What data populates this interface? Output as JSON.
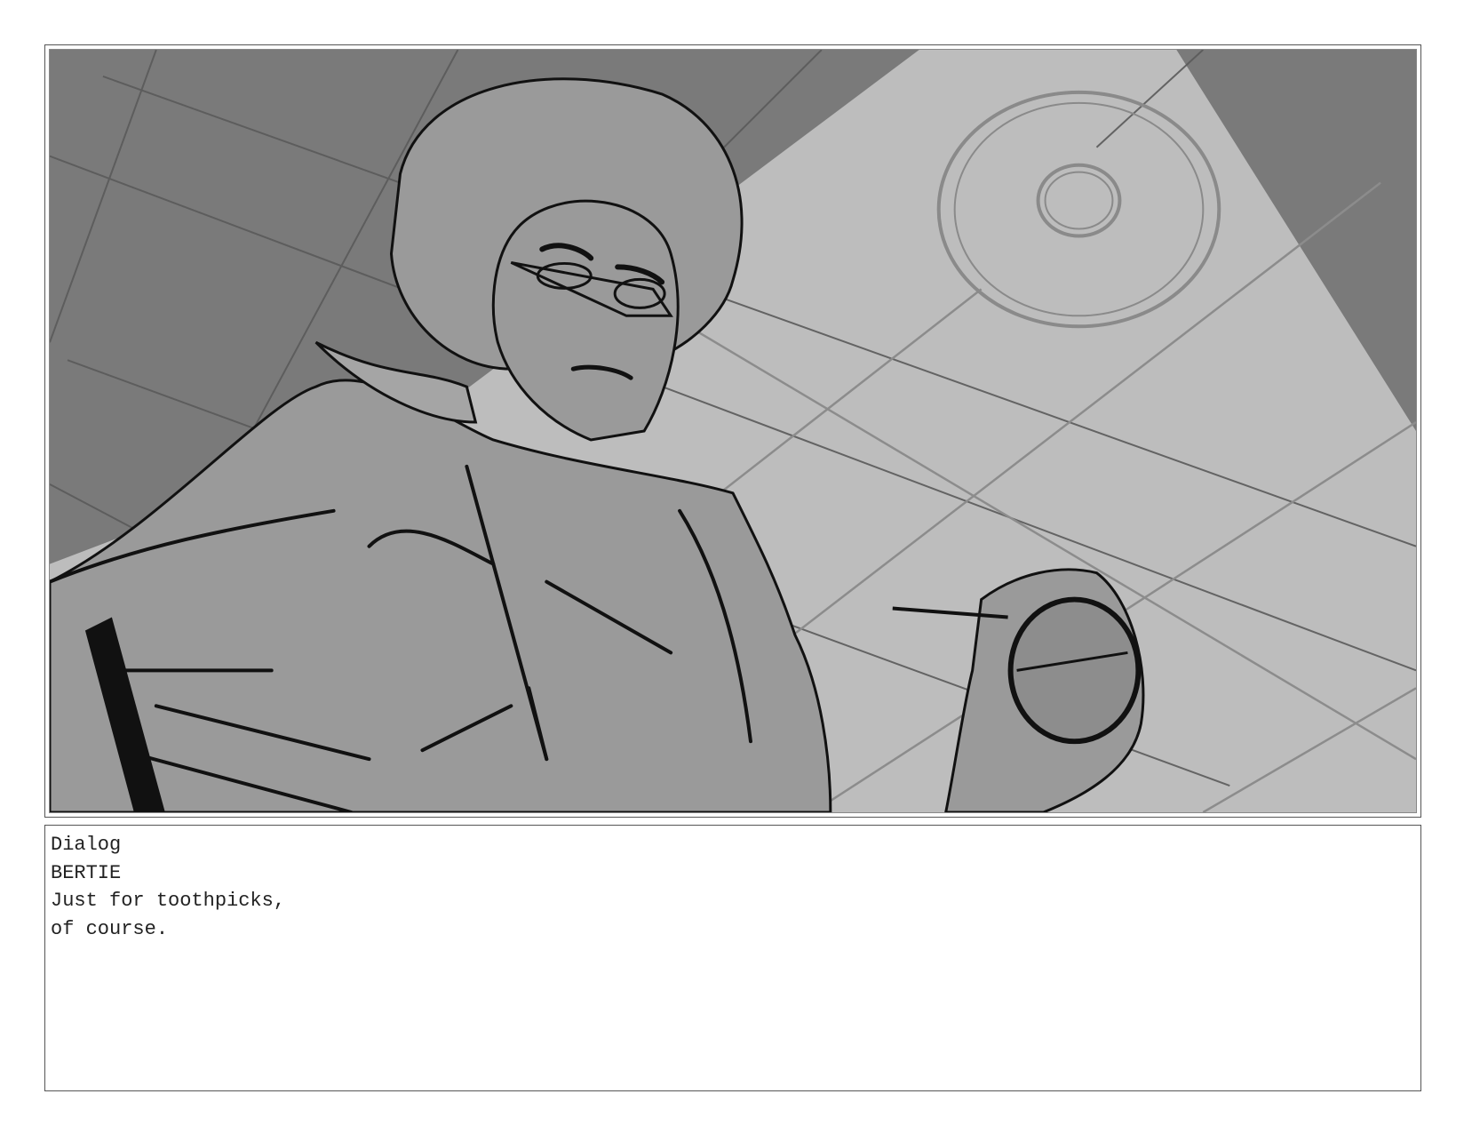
{
  "dialog": {
    "heading": "Dialog",
    "character": "BERTIE",
    "lines": [
      "Just for toothpicks,",
      "of course."
    ]
  },
  "colors": {
    "ceiling_dark": "#7a7a7a",
    "light_cone": "#bdbdbd",
    "figure_mid": "#9a9a9a",
    "ink": "#111111"
  }
}
